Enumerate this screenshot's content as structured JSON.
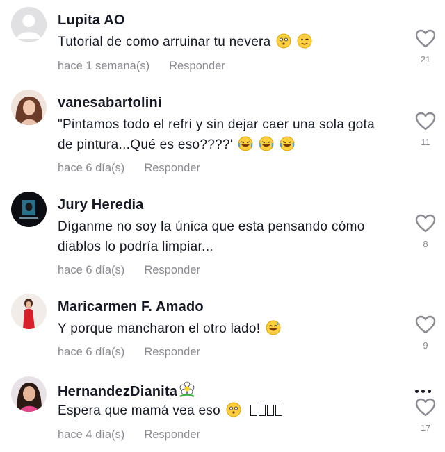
{
  "comments": [
    {
      "username": "Lupita AO",
      "text": "Tutorial de como arruinar tu nevera",
      "time": "hace 1 semana(s)",
      "reply": "Responder",
      "likes": "21",
      "avatar_color": "#e1e1e3"
    },
    {
      "username": "vanesabartolini",
      "text_line1": "\"Pintamos todo el refri y sin dejar caer una sola gota",
      "text_line2": "de pintura...Qué es eso????'",
      "time": "hace 6 día(s)",
      "reply": "Responder",
      "likes": "11"
    },
    {
      "username": "Jury Heredia",
      "text_line1": "Díganme no soy la única que esta pensando cómo",
      "text_line2": "diablos lo podría limpiar...",
      "time": "hace 6 día(s)",
      "reply": "Responder",
      "likes": "8"
    },
    {
      "username": "Maricarmen F. Amado",
      "text": "Y porque mancharon el otro lado!",
      "time": "hace 6 día(s)",
      "reply": "Responder",
      "likes": "9"
    },
    {
      "username": "HernandezDianita",
      "text": "Espera que mamá vea eso",
      "time": "hace 4 día(s)",
      "reply": "Responder",
      "likes": "17"
    }
  ],
  "icons": {
    "like": "heart-outline-icon",
    "more": "more-dots-icon"
  },
  "colors": {
    "text": "#161823",
    "muted": "#8a8b91",
    "background": "#ffffff"
  }
}
